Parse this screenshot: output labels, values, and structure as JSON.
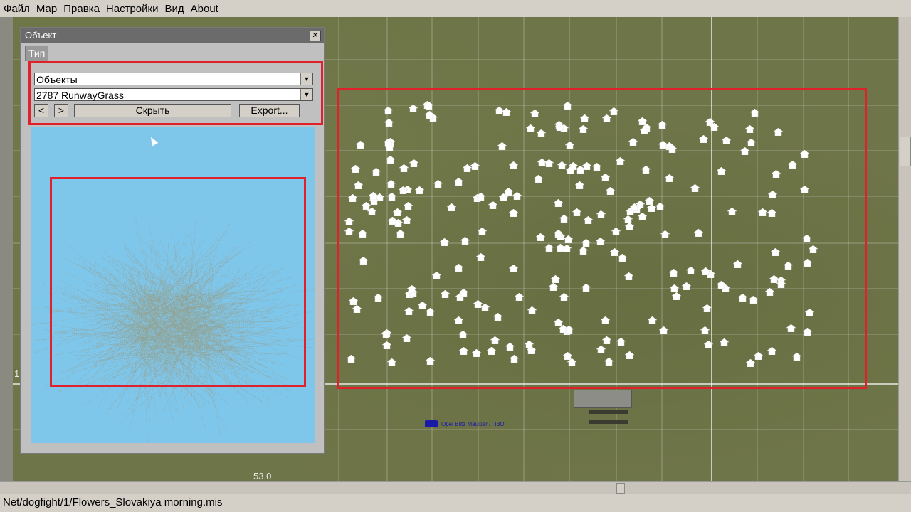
{
  "menu": [
    "Файл",
    "Мар",
    "Правка",
    "Настройки",
    "Вид",
    "About"
  ],
  "object_window": {
    "title": "Объект",
    "tab": "Тип",
    "category": "Объекты",
    "object": "2787 RunwayGrass",
    "prev_label": "<",
    "next_label": ">",
    "hide_label": "Скрыть",
    "export_label": "Export..."
  },
  "map": {
    "coordinate_label": "53.0",
    "left_label": "1",
    "unit_label": "Opel Blitz Maultier / ПВО"
  },
  "status": "Net/dogfight/1/Flowers_Slovakiya morning.mis",
  "colors": {
    "highlight": "#e0202a",
    "preview_bg": "#7fc6eb",
    "unit": "#1a1aa8"
  }
}
